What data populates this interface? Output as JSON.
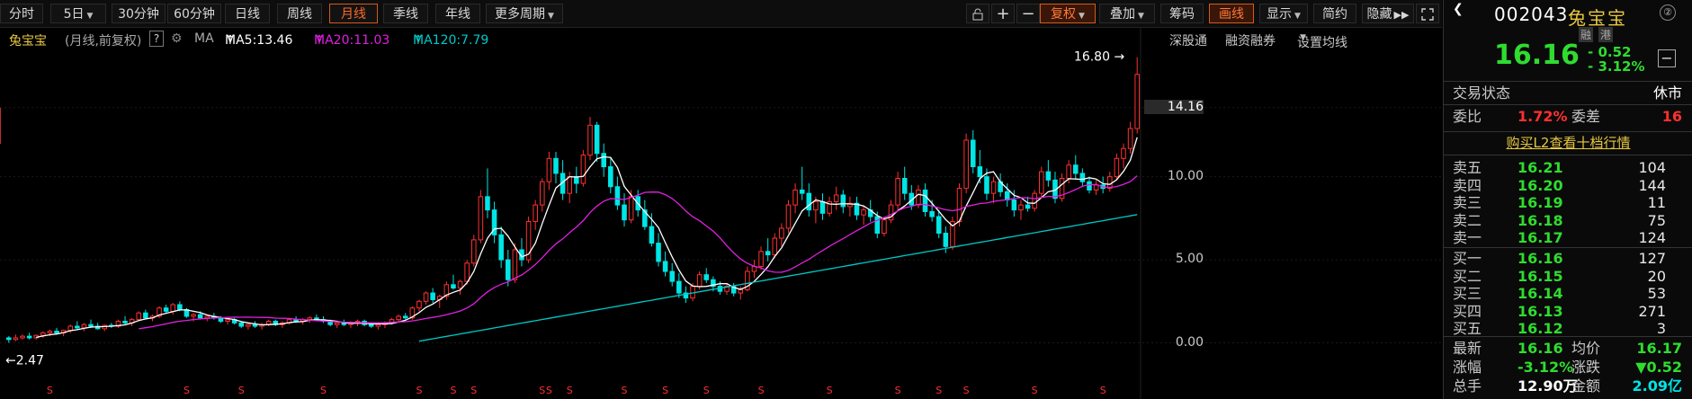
{
  "toolbar": {
    "left_buttons": [
      "分时",
      "5日",
      "30分钟",
      "60分钟",
      "日线",
      "周线",
      "月线",
      "季线",
      "年线",
      "更多周期"
    ],
    "right_buttons": [
      "复权",
      "叠加",
      "筹码",
      "画线",
      "显示",
      "简约",
      "隐藏"
    ],
    "active_period": "月线"
  },
  "info": {
    "stock_name": "兔宝宝",
    "desc": "(月线,前复权)",
    "help": "?",
    "ma_label": "MA",
    "ma5": "MA5:13.46",
    "ma20": "MA20:11.03",
    "ma120": "MA120:7.79",
    "links": [
      "深股通",
      "融资融券",
      "设置均线"
    ]
  },
  "chart_data": {
    "type": "candlestick",
    "title": "兔宝宝 (月线,前复权)",
    "y_ticks": [
      "14.16",
      "10.00",
      "5.00",
      "0.00"
    ],
    "y_range": [
      -1.0,
      17.5
    ],
    "high_label": "16.80",
    "low_label": "2.47",
    "current_price_tag": "14.16",
    "ohlc": [
      [
        0.3,
        0.4,
        0.0,
        0.2
      ],
      [
        0.2,
        0.5,
        0.1,
        0.3
      ],
      [
        0.3,
        0.5,
        0.2,
        0.4
      ],
      [
        0.4,
        0.6,
        0.2,
        0.3
      ],
      [
        0.3,
        0.5,
        0.2,
        0.45
      ],
      [
        0.45,
        0.7,
        0.3,
        0.6
      ],
      [
        0.6,
        0.8,
        0.4,
        0.7
      ],
      [
        0.7,
        0.9,
        0.5,
        0.6
      ],
      [
        0.6,
        0.8,
        0.4,
        0.75
      ],
      [
        0.75,
        1.1,
        0.6,
        1.0
      ],
      [
        1.0,
        1.3,
        0.8,
        0.9
      ],
      [
        0.9,
        1.2,
        0.7,
        1.1
      ],
      [
        1.1,
        1.4,
        0.9,
        1.0
      ],
      [
        1.0,
        1.2,
        0.8,
        0.85
      ],
      [
        0.85,
        1.1,
        0.7,
        1.05
      ],
      [
        1.05,
        1.2,
        0.9,
        1.0
      ],
      [
        1.0,
        1.4,
        0.9,
        1.3
      ],
      [
        1.3,
        1.6,
        1.1,
        1.2
      ],
      [
        1.2,
        1.5,
        1.0,
        1.4
      ],
      [
        1.4,
        1.9,
        1.3,
        1.8
      ],
      [
        1.8,
        2.0,
        1.4,
        1.5
      ],
      [
        1.5,
        1.7,
        1.3,
        1.6
      ],
      [
        1.6,
        2.2,
        1.5,
        2.1
      ],
      [
        2.1,
        2.3,
        1.8,
        1.9
      ],
      [
        1.9,
        2.4,
        1.7,
        2.3
      ],
      [
        2.3,
        2.5,
        1.9,
        2.0
      ],
      [
        2.0,
        2.1,
        1.5,
        1.6
      ],
      [
        1.6,
        1.8,
        1.3,
        1.7
      ],
      [
        1.7,
        1.9,
        1.4,
        1.5
      ],
      [
        1.5,
        1.7,
        1.3,
        1.6
      ],
      [
        1.6,
        1.8,
        1.4,
        1.5
      ],
      [
        1.5,
        1.6,
        1.2,
        1.3
      ],
      [
        1.3,
        1.5,
        1.1,
        1.4
      ],
      [
        1.4,
        1.5,
        1.1,
        1.2
      ],
      [
        1.2,
        1.3,
        0.9,
        1.0
      ],
      [
        1.0,
        1.2,
        0.8,
        1.1
      ],
      [
        1.1,
        1.3,
        0.9,
        1.0
      ],
      [
        1.0,
        1.2,
        0.8,
        1.1
      ],
      [
        1.1,
        1.4,
        1.0,
        1.3
      ],
      [
        1.3,
        1.4,
        1.0,
        1.1
      ],
      [
        1.1,
        1.3,
        0.9,
        1.2
      ],
      [
        1.2,
        1.5,
        1.1,
        1.4
      ],
      [
        1.4,
        1.6,
        1.2,
        1.3
      ],
      [
        1.3,
        1.5,
        1.1,
        1.4
      ],
      [
        1.4,
        1.6,
        1.2,
        1.5
      ],
      [
        1.5,
        1.7,
        1.3,
        1.4
      ],
      [
        1.4,
        1.6,
        1.2,
        1.3
      ],
      [
        1.3,
        1.4,
        1.0,
        1.1
      ],
      [
        1.1,
        1.3,
        0.9,
        1.2
      ],
      [
        1.2,
        1.4,
        1.0,
        1.1
      ],
      [
        1.1,
        1.3,
        0.9,
        1.2
      ],
      [
        1.2,
        1.4,
        1.0,
        1.3
      ],
      [
        1.3,
        1.4,
        1.0,
        1.1
      ],
      [
        1.1,
        1.2,
        0.9,
        1.0
      ],
      [
        1.0,
        1.2,
        0.8,
        1.1
      ],
      [
        1.1,
        1.3,
        0.9,
        1.2
      ],
      [
        1.2,
        1.5,
        1.1,
        1.4
      ],
      [
        1.4,
        1.7,
        1.3,
        1.6
      ],
      [
        1.6,
        1.8,
        1.4,
        1.5
      ],
      [
        1.5,
        2.2,
        1.4,
        2.1
      ],
      [
        2.1,
        2.6,
        1.9,
        2.5
      ],
      [
        2.5,
        3.1,
        2.3,
        3.0
      ],
      [
        3.0,
        3.3,
        2.4,
        2.6
      ],
      [
        2.6,
        2.9,
        2.1,
        2.8
      ],
      [
        2.8,
        3.7,
        2.6,
        3.5
      ],
      [
        3.5,
        4.1,
        3.2,
        3.3
      ],
      [
        3.3,
        3.8,
        2.9,
        3.7
      ],
      [
        3.7,
        5.0,
        3.5,
        4.8
      ],
      [
        4.8,
        6.5,
        4.6,
        6.2
      ],
      [
        6.2,
        9.2,
        6.0,
        8.8
      ],
      [
        8.8,
        10.5,
        7.5,
        8.0
      ],
      [
        8.0,
        8.5,
        6.0,
        6.5
      ],
      [
        6.5,
        7.0,
        4.5,
        5.0
      ],
      [
        5.0,
        5.6,
        3.4,
        3.8
      ],
      [
        3.8,
        6.0,
        3.6,
        5.6
      ],
      [
        5.6,
        6.3,
        4.6,
        5.0
      ],
      [
        5.0,
        7.6,
        4.8,
        7.3
      ],
      [
        7.3,
        8.6,
        6.8,
        8.3
      ],
      [
        8.3,
        9.9,
        7.9,
        9.7
      ],
      [
        9.7,
        11.5,
        9.2,
        11.1
      ],
      [
        11.1,
        11.5,
        9.6,
        10.2
      ],
      [
        10.2,
        11.0,
        8.6,
        9.0
      ],
      [
        9.0,
        10.3,
        8.4,
        10.0
      ],
      [
        10.0,
        10.6,
        9.0,
        9.6
      ],
      [
        9.6,
        11.6,
        9.4,
        11.3
      ],
      [
        11.3,
        13.6,
        11.0,
        13.1
      ],
      [
        13.1,
        13.3,
        10.9,
        11.4
      ],
      [
        11.4,
        12.0,
        10.0,
        10.6
      ],
      [
        10.6,
        11.2,
        9.0,
        9.4
      ],
      [
        9.4,
        10.0,
        8.0,
        8.3
      ],
      [
        8.3,
        9.0,
        7.0,
        7.4
      ],
      [
        7.4,
        9.2,
        7.2,
        8.8
      ],
      [
        8.8,
        9.2,
        7.6,
        8.0
      ],
      [
        8.0,
        8.6,
        6.8,
        7.0
      ],
      [
        7.0,
        7.8,
        5.8,
        6.0
      ],
      [
        6.0,
        6.6,
        4.6,
        4.9
      ],
      [
        4.9,
        5.5,
        4.0,
        4.3
      ],
      [
        4.3,
        4.8,
        3.4,
        3.7
      ],
      [
        3.7,
        4.2,
        2.7,
        3.0
      ],
      [
        3.0,
        3.4,
        2.4,
        2.7
      ],
      [
        2.7,
        3.6,
        2.5,
        3.4
      ],
      [
        3.4,
        4.3,
        3.2,
        4.1
      ],
      [
        4.1,
        4.5,
        3.6,
        3.8
      ],
      [
        3.8,
        4.0,
        3.1,
        3.4
      ],
      [
        3.4,
        3.7,
        2.9,
        3.1
      ],
      [
        3.1,
        3.6,
        2.9,
        3.4
      ],
      [
        3.4,
        3.6,
        2.8,
        3.0
      ],
      [
        3.0,
        3.4,
        2.6,
        3.2
      ],
      [
        3.2,
        4.6,
        3.1,
        4.3
      ],
      [
        4.3,
        5.0,
        3.9,
        4.6
      ],
      [
        4.6,
        5.8,
        4.4,
        5.5
      ],
      [
        5.5,
        6.3,
        4.9,
        5.3
      ],
      [
        5.3,
        6.6,
        5.1,
        6.3
      ],
      [
        6.3,
        7.2,
        5.8,
        6.9
      ],
      [
        6.9,
        8.6,
        6.6,
        8.3
      ],
      [
        8.3,
        9.6,
        7.8,
        9.2
      ],
      [
        9.2,
        10.6,
        8.6,
        9.0
      ],
      [
        9.0,
        9.6,
        7.6,
        8.0
      ],
      [
        8.0,
        8.8,
        7.2,
        8.5
      ],
      [
        8.5,
        9.0,
        7.4,
        7.8
      ],
      [
        7.8,
        8.8,
        7.6,
        8.5
      ],
      [
        8.5,
        9.4,
        8.0,
        8.9
      ],
      [
        8.9,
        9.2,
        7.8,
        8.2
      ],
      [
        8.2,
        8.8,
        7.6,
        8.4
      ],
      [
        8.4,
        8.8,
        7.4,
        7.7
      ],
      [
        7.7,
        8.3,
        7.1,
        8.0
      ],
      [
        8.0,
        8.6,
        7.3,
        7.6
      ],
      [
        7.6,
        7.9,
        6.3,
        6.6
      ],
      [
        6.6,
        7.6,
        6.4,
        7.4
      ],
      [
        7.4,
        8.6,
        7.2,
        8.3
      ],
      [
        8.3,
        10.3,
        8.0,
        9.9
      ],
      [
        9.9,
        10.6,
        8.6,
        9.0
      ],
      [
        9.0,
        9.5,
        8.0,
        8.3
      ],
      [
        8.3,
        9.5,
        8.1,
        9.2
      ],
      [
        9.2,
        9.6,
        7.6,
        7.9
      ],
      [
        7.9,
        8.6,
        7.3,
        7.6
      ],
      [
        7.6,
        8.0,
        6.3,
        6.6
      ],
      [
        6.6,
        7.0,
        5.4,
        5.8
      ],
      [
        5.8,
        7.6,
        5.6,
        7.3
      ],
      [
        7.3,
        9.6,
        7.0,
        9.3
      ],
      [
        9.3,
        12.6,
        9.0,
        12.2
      ],
      [
        12.2,
        12.8,
        10.2,
        10.6
      ],
      [
        10.6,
        11.6,
        9.6,
        10.0
      ],
      [
        10.0,
        10.5,
        8.6,
        9.0
      ],
      [
        9.0,
        10.0,
        8.4,
        9.7
      ],
      [
        9.7,
        10.2,
        8.8,
        9.1
      ],
      [
        9.1,
        9.6,
        8.2,
        8.6
      ],
      [
        8.6,
        9.2,
        7.6,
        8.0
      ],
      [
        8.0,
        8.6,
        7.4,
        8.3
      ],
      [
        8.3,
        8.8,
        7.9,
        8.1
      ],
      [
        8.1,
        9.2,
        7.9,
        9.0
      ],
      [
        9.0,
        10.6,
        8.8,
        10.3
      ],
      [
        10.3,
        11.0,
        9.4,
        9.8
      ],
      [
        9.8,
        10.3,
        8.4,
        8.7
      ],
      [
        8.7,
        10.2,
        8.5,
        9.9
      ],
      [
        9.9,
        11.0,
        9.6,
        10.7
      ],
      [
        10.7,
        11.3,
        9.9,
        10.2
      ],
      [
        10.2,
        10.5,
        9.4,
        9.7
      ],
      [
        9.7,
        10.0,
        9.0,
        9.2
      ],
      [
        9.2,
        9.8,
        8.9,
        9.5
      ],
      [
        9.5,
        10.0,
        9.0,
        9.3
      ],
      [
        9.3,
        10.3,
        9.1,
        10.0
      ],
      [
        10.0,
        11.4,
        9.8,
        11.1
      ],
      [
        11.1,
        12.0,
        10.5,
        11.7
      ],
      [
        11.7,
        13.3,
        11.4,
        12.9
      ],
      [
        12.9,
        17.2,
        12.6,
        16.16
      ]
    ]
  },
  "panel": {
    "code": "002043",
    "name": "兔宝宝",
    "badge1": "融",
    "badge2": "港",
    "price": "16.16",
    "change": "- 0.52",
    "change_pct": "- 3.12%",
    "status_label": "交易状态",
    "status_value": "休市",
    "weibi_label": "委比",
    "weibi_value": "1.72%",
    "weicha_label": "委差",
    "weicha_value": "16",
    "l2_link": "购买L2查看十档行情",
    "asks": [
      {
        "label": "卖五",
        "price": "16.21",
        "vol": "104"
      },
      {
        "label": "卖四",
        "price": "16.20",
        "vol": "144"
      },
      {
        "label": "卖三",
        "price": "16.19",
        "vol": "11"
      },
      {
        "label": "卖二",
        "price": "16.18",
        "vol": "75"
      },
      {
        "label": "卖一",
        "price": "16.17",
        "vol": "124"
      }
    ],
    "bids": [
      {
        "label": "买一",
        "price": "16.16",
        "vol": "127"
      },
      {
        "label": "买二",
        "price": "16.15",
        "vol": "20"
      },
      {
        "label": "买三",
        "price": "16.14",
        "vol": "53"
      },
      {
        "label": "买四",
        "price": "16.13",
        "vol": "271"
      },
      {
        "label": "买五",
        "price": "16.12",
        "vol": "3"
      }
    ],
    "stats": [
      {
        "l1": "最新",
        "v1": "16.16",
        "l2": "均价",
        "v2": "16.17"
      },
      {
        "l1": "涨幅",
        "v1": "-3.12%",
        "l2": "涨跌",
        "v2": "▼0.52"
      },
      {
        "l1": "总手",
        "v1": "12.90万",
        "l2": "金额",
        "v2": "2.09亿"
      }
    ]
  },
  "colors": {
    "up": "#ff3030",
    "down": "#00e5e5",
    "ma5": "#ffffff",
    "ma20": "#e020e0",
    "ma120": "#00c8c8",
    "green": "#2fdc2f",
    "accent": "#ff6a2a"
  }
}
